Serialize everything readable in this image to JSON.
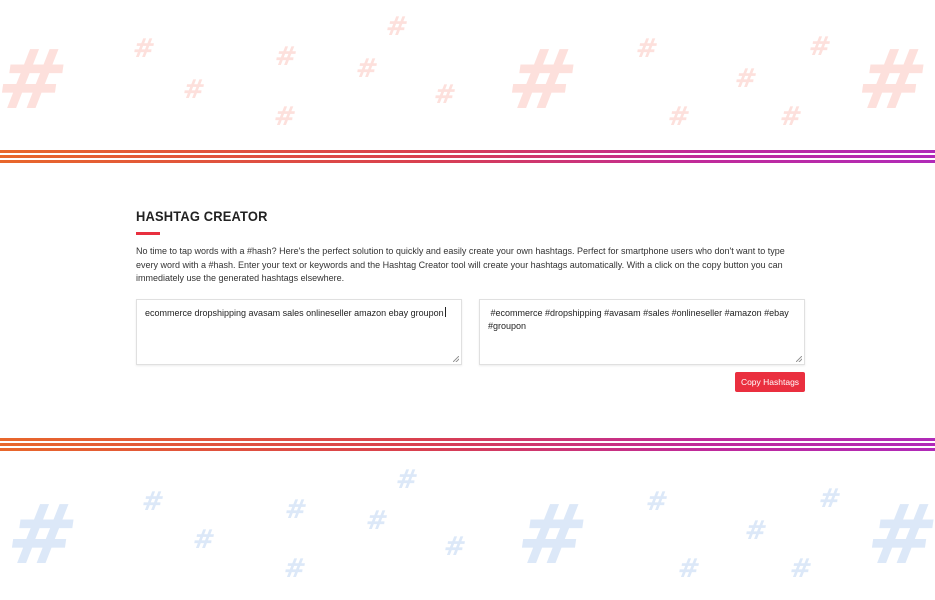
{
  "decoration": {
    "glyph": "#",
    "top_color": "#fde0dc",
    "bottom_color": "#dce8f8",
    "stripe_gradient": [
      "#e8672b",
      "#d9404f",
      "#c02a9a",
      "#b02ab8"
    ]
  },
  "main": {
    "title": "HASHTAG CREATOR",
    "accent_color": "#e8303f",
    "description": "No time to tap words with a #hash? Here's the perfect solution to quickly and easily create your own hashtags. Perfect for smartphone users who don't want to type every word with a #hash. Enter your text or keywords and the Hashtag Creator tool will create your hashtags automatically. With a click on the copy button you can immediately use the generated hashtags elsewhere."
  },
  "editor": {
    "input_value": "ecommerce dropshipping avasam sales onlineseller amazon ebay groupon",
    "output_value": " #ecommerce #dropshipping #avasam #sales #onlineseller #amazon #ebay #groupon"
  },
  "actions": {
    "copy_label": "Copy Hashtags",
    "copy_color": "#ea2f3f"
  }
}
